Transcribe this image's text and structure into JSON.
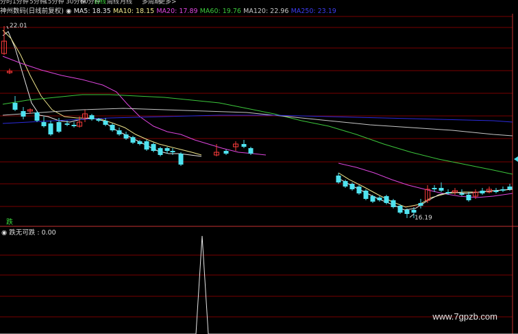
{
  "toolbar": [
    "分时",
    "1分钟",
    "5分钟",
    "15分钟",
    "30分钟",
    "60分钟",
    "日线",
    "周线",
    "月线",
    "多周期",
    "更多>"
  ],
  "legend": {
    "stock": "神州数码(日线前复权)",
    "ma5_label": "MA5: 18.35",
    "ma10_label": "MA10: 18.15",
    "ma20_label": "MA20: 17.89",
    "ma60_label": "MA60: 19.76",
    "ma120_label": "MA120: 22.96",
    "ma250_label": "MA250: 23.19"
  },
  "sub_legend": "跌无可跌 : 0.00",
  "signal_text": "跌",
  "watermark": "www.7gpzb.com",
  "colors": {
    "up": "#ff3c3c",
    "down": "#4fe3f0",
    "ma5": "#e8e8e8",
    "ma10": "#f0e68c",
    "ma20": "#e046e0",
    "ma60": "#3cc83c",
    "ma120": "#c8c8c8",
    "ma250": "#2c2ce0",
    "grid": "#7a0000"
  },
  "chart_data": {
    "type": "candlestick",
    "annotations": [
      {
        "label": "22.01",
        "kind": "high"
      },
      {
        "label": "16.19",
        "kind": "low"
      }
    ],
    "ma_series": [
      "MA5",
      "MA10",
      "MA20",
      "MA60",
      "MA120",
      "MA250"
    ],
    "sub_series": {
      "name": "跌无可跌",
      "value": 0.0
    }
  }
}
